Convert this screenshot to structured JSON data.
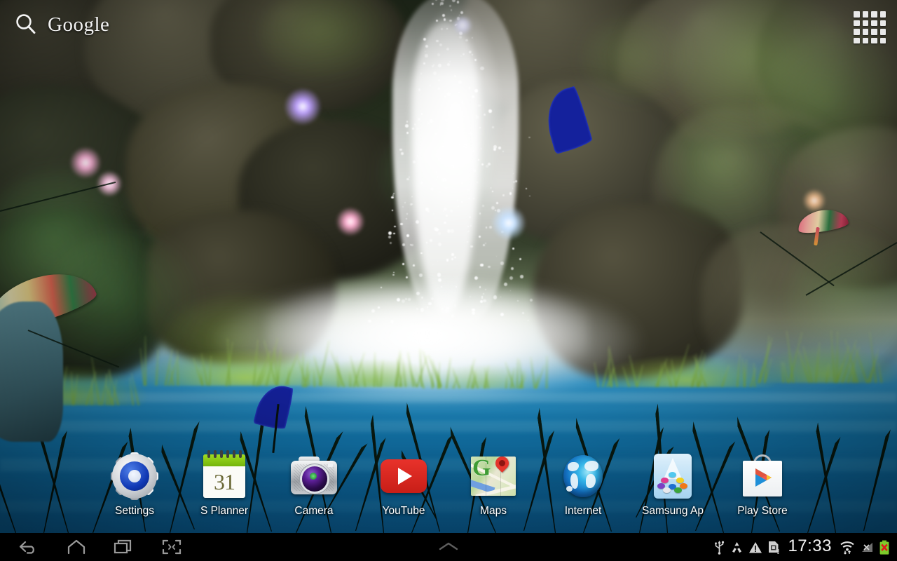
{
  "search_widget": {
    "icon": "search-icon",
    "brand": "Google"
  },
  "app_drawer": {
    "icon": "apps-grid-icon",
    "cells": 16
  },
  "dock": {
    "apps": [
      {
        "label": "Settings",
        "icon": "settings-gear-icon"
      },
      {
        "label": "S Planner",
        "icon": "calendar-icon",
        "day": "31"
      },
      {
        "label": "Camera",
        "icon": "camera-icon"
      },
      {
        "label": "YouTube",
        "icon": "youtube-icon"
      },
      {
        "label": "Maps",
        "icon": "maps-icon",
        "glyph": "G"
      },
      {
        "label": "Internet",
        "icon": "globe-icon"
      },
      {
        "label": "Samsung Ap",
        "icon": "samsung-apps-icon"
      },
      {
        "label": "Play Store",
        "icon": "play-store-icon"
      }
    ]
  },
  "navbar": {
    "back": "back-icon",
    "home": "home-icon",
    "recents": "recents-icon",
    "screenshot": "screen-capture-icon",
    "drawer_handle": "chevron-up-icon"
  },
  "statusbar": {
    "time": "17:33",
    "icons": [
      "usb-icon",
      "recycle-icon",
      "warning-triangle-icon",
      "sim-card-alert-icon",
      "wifi-transfer-icon",
      "signal-no-service-icon",
      "battery-error-icon"
    ]
  },
  "wallpaper": {
    "name": "waterfall-forest-live-wallpaper",
    "colors": {
      "moss_green": "#3f5a2a",
      "rock_grey": "#6b6a58",
      "water_blue": "#1478ae",
      "spray_white": "#ffffff",
      "leaf_blue": "#14219c",
      "orb_purple": "#a487f0",
      "orb_pink": "#f0a0c8"
    }
  }
}
